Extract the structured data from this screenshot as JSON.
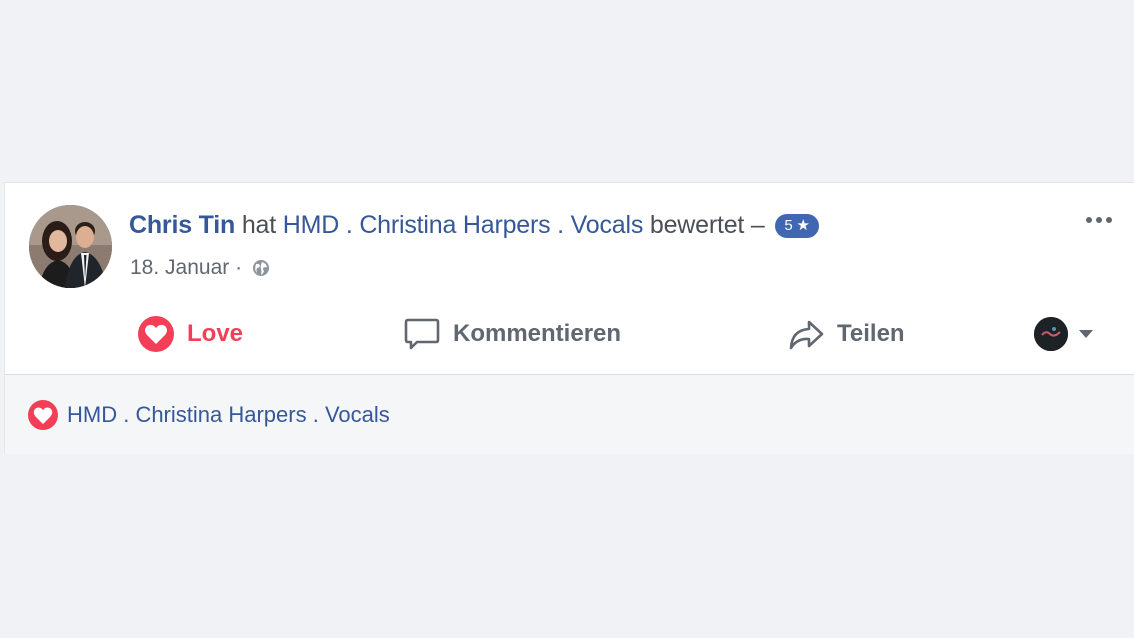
{
  "post": {
    "author": "Chris Tin",
    "verb": "hat",
    "page": "HMD . Christina Harpers . Vocals",
    "action": "bewertet –",
    "rating": "5 ★",
    "date": "18. Januar",
    "separator": "·"
  },
  "actions": {
    "love": "Love",
    "comment": "Kommentieren",
    "share": "Teilen"
  },
  "reactions": {
    "name": "HMD . Christina Harpers . Vocals"
  },
  "colors": {
    "link": "#365899",
    "love": "#f33e58",
    "badge": "#4267b2",
    "background": "#f0f2f5"
  },
  "icons": [
    "globe-icon",
    "more-icon",
    "heart-icon",
    "comment-icon",
    "share-icon",
    "chevron-down-icon"
  ]
}
